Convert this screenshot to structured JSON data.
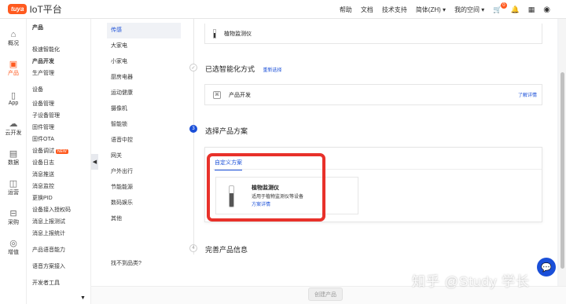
{
  "brand": {
    "badge": "tuya",
    "name": "IoT平台"
  },
  "topnav": {
    "help": "帮助",
    "docs": "文档",
    "support": "技术支持",
    "lang": "简体(ZH)",
    "space": "我的空间",
    "cart_count": "0"
  },
  "iconbar": [
    {
      "label": "概况",
      "icon": "home-icon"
    },
    {
      "label": "产品",
      "icon": "product-icon"
    },
    {
      "label": "App",
      "icon": "app-icon"
    },
    {
      "label": "云开发",
      "icon": "cloud-icon"
    },
    {
      "label": "数据",
      "icon": "data-icon"
    },
    {
      "label": "运营",
      "icon": "operation-icon"
    },
    {
      "label": "采购",
      "icon": "cart-icon"
    },
    {
      "label": "增值",
      "icon": "value-added-icon"
    }
  ],
  "subnav": {
    "title": "产品",
    "group1": "极速智能化",
    "group1_items": [
      "产品开发",
      "生产管理"
    ],
    "group2": "设备",
    "group2_items": [
      "设备管理",
      "子设备管理",
      "固件管理",
      "固件OTA",
      "设备调试",
      "设备日志",
      "消息推送",
      "消息监控",
      "更换PID",
      "设备接入授权码",
      "消息上报测试",
      "消息上报统计"
    ],
    "new_badge": "NEW",
    "group3": "产品语音能力",
    "group3_items": [
      "语音方案接入"
    ],
    "group4": "开发者工具"
  },
  "categories": [
    "传感",
    "大家电",
    "小家电",
    "厨房电器",
    "运动健康",
    "摄像机",
    "智能锁",
    "语音中控",
    "网关",
    "户外出行",
    "节能能源",
    "数码娱乐",
    "其他"
  ],
  "category_footer": "找不到品类?",
  "step1": {
    "product": "植物监测仪"
  },
  "step2": {
    "title": "已选智能化方式",
    "action": "重新选择",
    "method": "产品开发",
    "more": "了解详情"
  },
  "step3": {
    "num": "3",
    "title": "选择产品方案",
    "tab": "自定义方案",
    "plan_name": "植物监测仪",
    "plan_desc": "适用于植物监测仪等设备",
    "plan_link": "方案详情"
  },
  "step4": {
    "num": "4",
    "title": "完善产品信息"
  },
  "create_button": "创建产品",
  "watermark": "知乎 @Study 学长"
}
